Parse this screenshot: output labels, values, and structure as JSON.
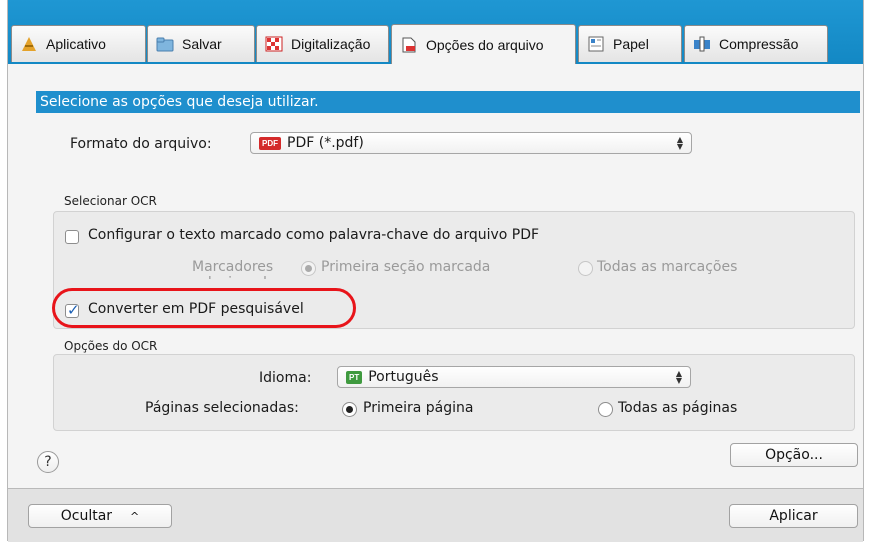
{
  "tabs": [
    {
      "label": "Aplicativo",
      "icon": "application-icon"
    },
    {
      "label": "Salvar",
      "icon": "folder-icon"
    },
    {
      "label": "Digitalização",
      "icon": "scan-icon"
    },
    {
      "label": "Opções do arquivo",
      "icon": "file-options-icon",
      "active": true
    },
    {
      "label": "Papel",
      "icon": "paper-icon"
    },
    {
      "label": "Compressão",
      "icon": "compression-icon"
    }
  ],
  "content": {
    "header": "Selecione as opções que deseja utilizar.",
    "file_format": {
      "label": "Formato do arquivo:",
      "badge": "PDF",
      "value": "PDF (*.pdf)"
    },
    "ocr_select": {
      "title": "Selecionar OCR",
      "keyword_checkbox": {
        "label": "Configurar o texto marcado como palavra-chave do arquivo PDF",
        "checked": false
      },
      "markers_label": "Marcadores selecionados:",
      "markers_options": [
        "Primeira seção marcada",
        "Todas as marcações"
      ],
      "markers_selected": "Primeira seção marcada",
      "searchable_checkbox": {
        "label": "Converter em PDF pesquisável",
        "checked": true
      }
    },
    "ocr_options": {
      "title": "Opções do OCR",
      "language_label": "Idioma:",
      "language_badge": "PT",
      "language_value": "Português",
      "pages_label": "Páginas selecionadas:",
      "pages_options": [
        "Primeira página",
        "Todas as páginas"
      ],
      "pages_selected": "Primeira página"
    },
    "option_button": "Opção...",
    "help": "?"
  },
  "footer": {
    "hide_button": "Ocultar",
    "hide_chevron": "^",
    "apply_button": "Aplicar"
  },
  "colors": {
    "accent": "#1f8fcd",
    "highlight": "#e8141a",
    "pdf_badge": "#d42a2a",
    "pt_badge": "#3f9a3f"
  }
}
